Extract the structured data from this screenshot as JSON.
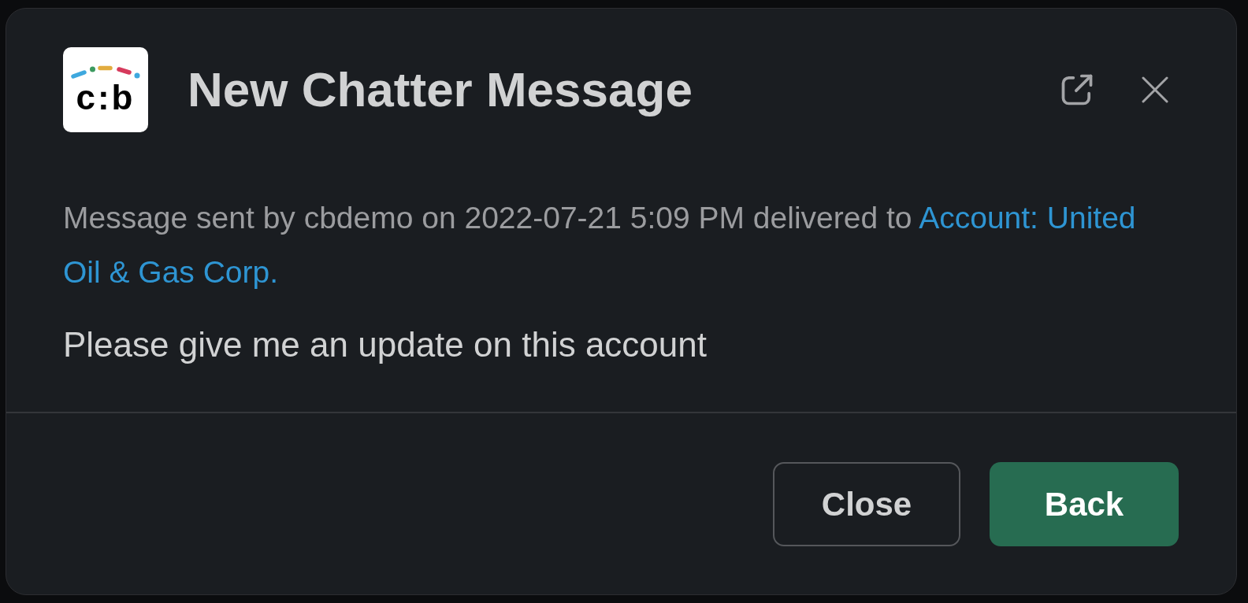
{
  "dialog": {
    "logo_text": "c:b",
    "title": "New Chatter Message",
    "meta": {
      "text": "Message sent by cbdemo on 2022-07-21 5:09 PM delivered to",
      "link_lines": [
        "Account: United",
        "Oil & Gas Corp."
      ]
    },
    "message": "Please give me an update on this account",
    "buttons": [
      {
        "label": "Close",
        "kind": "secondary"
      },
      {
        "label": "Back",
        "kind": "primary"
      }
    ]
  }
}
